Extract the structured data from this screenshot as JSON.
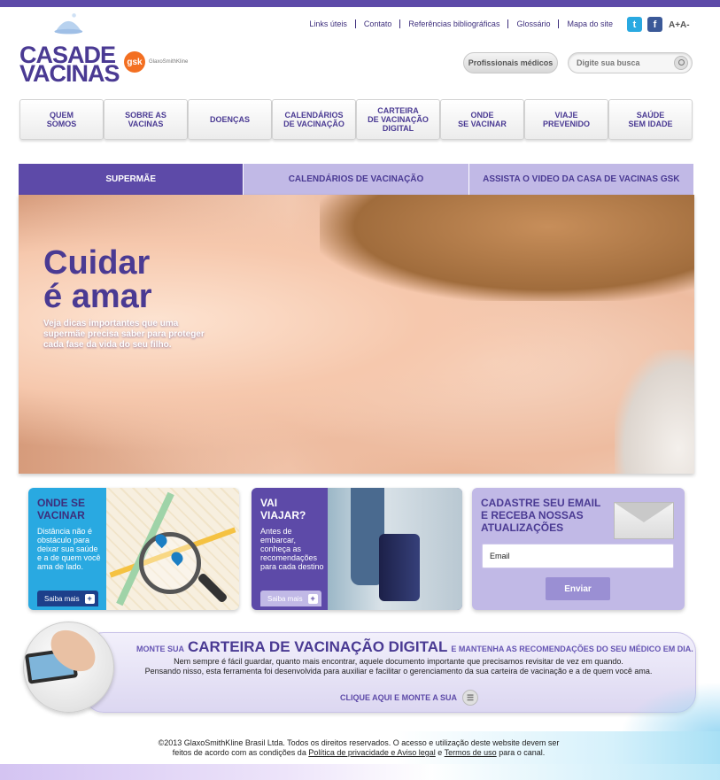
{
  "brand": {
    "logo_line1": "CASADE",
    "logo_line2": "VACINAS",
    "partner": "gsk",
    "partner_sub": "GlaxoSmithKline"
  },
  "top_links": [
    "Links úteis",
    "Contato",
    "Referências bibliográficas",
    "Glossário",
    "Mapa do site"
  ],
  "social": {
    "twitter": "t",
    "facebook": "f"
  },
  "font_size": "A+A-",
  "professionals_button": "Profissionais médicos",
  "search": {
    "placeholder": "Digite sua busca"
  },
  "nav": [
    "QUEM\nSOMOS",
    "SOBRE AS\nVACINAS",
    "DOENÇAS",
    "CALENDÁRIOS\nDE VACINAÇÃO",
    "CARTEIRA\nDE VACINAÇÃO\nDIGITAL",
    "ONDE\nSE VACINAR",
    "VIAJE\nPREVENIDO",
    "SAÚDE\nSEM IDADE"
  ],
  "tabs": [
    "SUPERMÃE",
    "CALENDÁRIOS DE VACINAÇÃO",
    "ASSISTA O VIDEO DA CASA DE VACINAS GSK"
  ],
  "hero": {
    "title": "Cuidar\né amar",
    "text": "Veja dicas importantes que uma supermãe precisa saber para proteger cada fase da vida do seu filho."
  },
  "box1": {
    "title": "ONDE SE\nVACINAR",
    "text": "Distância não é obstáculo para deixar sua saúde e a de quem você ama de lado.",
    "button": "Saiba mais"
  },
  "box2": {
    "title": "VAI\nVIAJAR?",
    "text": "Antes de embarcar, conheça as recomendações para cada destino",
    "button": "Saiba mais"
  },
  "box3": {
    "title": "CADASTRE SEU EMAIL\nE RECEBA NOSSAS\nATUALIZAÇÕES",
    "email_value": "Email",
    "button": "Enviar"
  },
  "banner": {
    "pre": "MONTE SUA",
    "big": "CARTEIRA DE VACINAÇÃO DIGITAL",
    "post": "E MANTENHA AS RECOMENDAÇÕES DO SEU MÉDICO EM DIA.",
    "line1": "Nem sempre é fácil guardar, quanto mais encontrar, aquele documento importante que precisamos revisitar de vez em quando.",
    "line2": "Pensando nisso, esta ferramenta foi desenvolvida para auxiliar e facilitar o gerenciamento da sua carteira de vacinação e a de quem você ama.",
    "cta": "CLIQUE AQUI E MONTE A SUA"
  },
  "footer": {
    "line1": "©2013 GlaxoSmithKline Brasil Ltda. Todos os direitos reservados. O acesso e utilização deste website devem ser",
    "line2_pre": "feitos de acordo com as condições da",
    "link1": "Política de privacidade e Aviso legal",
    "and": "e",
    "link2": "Termos de uso",
    "line2_post": "para o canal."
  },
  "colors": {
    "primary": "#5d4aa8",
    "light": "#c1b9e6",
    "blue": "#29a9e1"
  }
}
